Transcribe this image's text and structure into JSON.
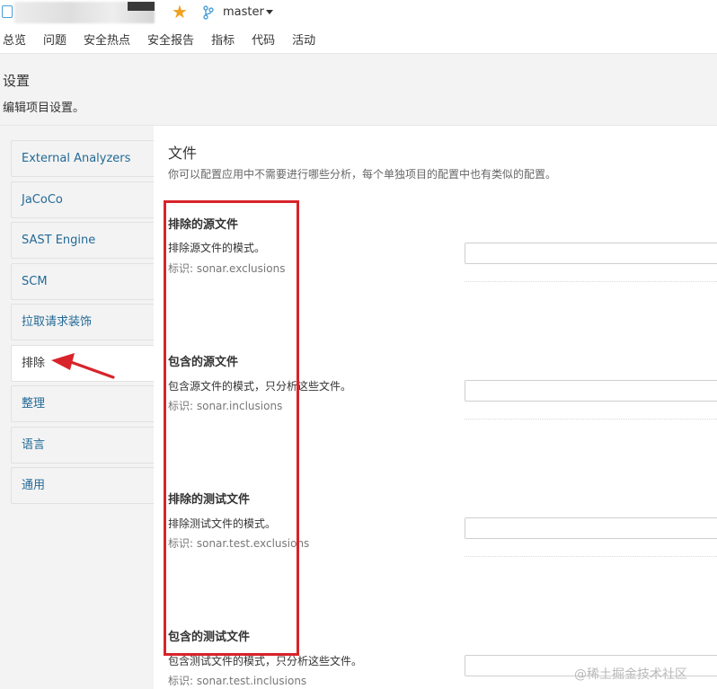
{
  "topbar": {
    "branch": "master"
  },
  "nav": {
    "items": [
      "总览",
      "问题",
      "安全热点",
      "安全报告",
      "指标",
      "代码",
      "活动"
    ]
  },
  "header": {
    "title": "设置",
    "description": "编辑项目设置。"
  },
  "sidebar": {
    "items": [
      {
        "label": "External Analyzers"
      },
      {
        "label": "JaCoCo"
      },
      {
        "label": "SAST Engine"
      },
      {
        "label": "SCM"
      },
      {
        "label": "拉取请求装饰"
      },
      {
        "label": "排除"
      },
      {
        "label": "整理"
      },
      {
        "label": "语言"
      },
      {
        "label": "通用"
      }
    ],
    "active_index": 5
  },
  "main": {
    "section_title": "文件",
    "section_desc": "你可以配置应用中不需要进行哪些分析，每个单独项目的配置中也有类似的配置。",
    "settings": [
      {
        "name": "排除的源文件",
        "description": "排除源文件的模式。",
        "key": "标识: sonar.exclusions",
        "value": ""
      },
      {
        "name": "包含的源文件",
        "description": "包含源文件的模式，只分析这些文件。",
        "key": "标识: sonar.inclusions",
        "value": ""
      },
      {
        "name": "排除的测试文件",
        "description": "排除测试文件的模式。",
        "key": "标识: sonar.test.exclusions",
        "value": ""
      },
      {
        "name": "包含的测试文件",
        "description": "包含测试文件的模式，只分析这些文件。",
        "key": "标识: sonar.test.inclusions",
        "value": ""
      }
    ]
  },
  "watermark": "@稀土掘金技术社区",
  "colors": {
    "link": "#236a97",
    "annotation": "#d8232a",
    "star": "#f0a021"
  }
}
